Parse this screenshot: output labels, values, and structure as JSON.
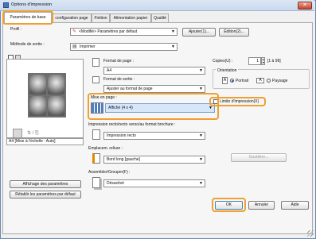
{
  "window": {
    "title": "Options d'impression",
    "close_glyph": "✕"
  },
  "tabs": [
    {
      "label": "Paramètres de base"
    },
    {
      "label": "configuration page"
    },
    {
      "label": "Finition"
    },
    {
      "label": "Alimentation papier"
    },
    {
      "label": "Qualité"
    }
  ],
  "profile": {
    "label": "Profil :",
    "value": "<Modifié> Paramètres par défaut",
    "add_button": "Ajouter(1)...",
    "edit_button": "Édition(2)..."
  },
  "output": {
    "label": "Méthode de sortie :",
    "value": "Imprimer"
  },
  "page_size": {
    "label": "Format de page :",
    "value": "A4"
  },
  "output_size": {
    "label": "Format de sortie :",
    "value": "Ajuster au format de page"
  },
  "copies": {
    "label": "Copies(U) :",
    "value": "1",
    "range": "[1 à 99]"
  },
  "orientation": {
    "label": "Orientation",
    "portrait": "Portrait",
    "landscape": "Paysage",
    "portrait_letter": "A",
    "landscape_letter": "A"
  },
  "layout": {
    "label": "Mise en page :",
    "value": "Affiché (4 x 4)",
    "limit_label": "Limite d'impression(X)"
  },
  "duplex": {
    "label": "Impression recto/recto verso/au format brochure :",
    "value": "Impression recto"
  },
  "binding": {
    "label": "Emplacem. reliure :",
    "value": "Bord long [gauche]",
    "gutter_button": "Gouttière..."
  },
  "finishing": {
    "label": "Assembler/Grouper(F) :",
    "value": "Désactivé"
  },
  "preview": {
    "caption": "A4 [Mise à l'échelle : Auto]"
  },
  "left_buttons": {
    "view_settings": "Affichage des paramètres",
    "restore_defaults": "Rétablir les paramètres par défaut"
  },
  "footer": {
    "ok": "OK",
    "cancel": "Annuler",
    "help": "Aide"
  },
  "colors": {
    "highlight": "#f0a030",
    "selection": "#d7e6f8"
  }
}
